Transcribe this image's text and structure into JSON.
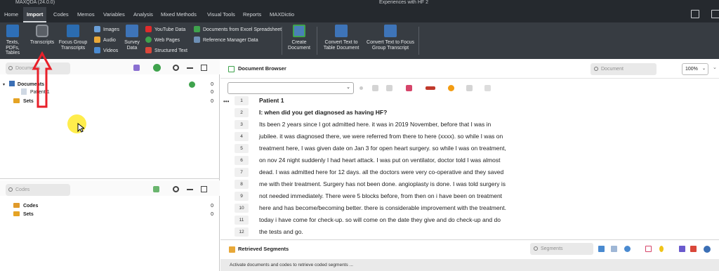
{
  "title_bar": {
    "app_title": "MAXQDA (24.0.0)",
    "window_title": "Experiences with HF 2"
  },
  "menu": [
    "Home",
    "Import",
    "Codes",
    "Memos",
    "Variables",
    "Analysis",
    "Mixed Methods",
    "Visual Tools",
    "Reports",
    "MAXDictio"
  ],
  "menu_active": "Import",
  "ribbon": {
    "texts": "Texts, PDFs, Tables",
    "transcripts": "Transcripts",
    "focus_group": "Focus Group Transcripts",
    "images": "Images",
    "audio": "Audio",
    "videos": "Videos",
    "survey": "Survey Data",
    "youtube": "YouTube Data",
    "web_pages": "Web Pages",
    "structured_text": "Structured Text",
    "excel": "Documents from Excel Spreadsheet",
    "reference": "Reference Manager Data",
    "create_document": "Create Document",
    "convert_table": "Convert Text to Table Document",
    "convert_focus": "Convert Text to Focus Group Transcript"
  },
  "document_system": {
    "search_placeholder": "Documents",
    "root_label": "Documents",
    "root_count": "0",
    "children": [
      {
        "label": "Patient 1",
        "count": "0"
      }
    ],
    "sets_label": "Sets",
    "sets_count": "0"
  },
  "code_system": {
    "search_placeholder": "Codes",
    "codes_label": "Codes",
    "codes_count": "0",
    "sets_label": "Sets",
    "sets_count": "0"
  },
  "document_browser": {
    "title": "Document Browser",
    "search_placeholder": "Document",
    "zoom": "100%",
    "lines": [
      {
        "n": "1",
        "text": "Patient 1",
        "bold": true
      },
      {
        "n": "2",
        "text": "I: when did you get diagnosed as having HF?",
        "bold": true
      },
      {
        "n": "3",
        "text": "Its been 2 years since I got admitted here. it was in 2019 November, before that I was in"
      },
      {
        "n": "4",
        "text": "jubilee. it was diagnosed there, we were referred from there to here (xxxx). so while I was on"
      },
      {
        "n": "5",
        "text": "treatment here, I was given date on Jan 3 for open heart surgery. so while I was on treatment,"
      },
      {
        "n": "6",
        "text": "on nov 24 night suddenly I had heart attack. I was put on ventilator, doctor told I was almost"
      },
      {
        "n": "7",
        "text": "dead. I was admitted here for 12 days. all the doctors were very co-operative and they saved"
      },
      {
        "n": "8",
        "text": "me with their treatment. Surgery has not been done. angioplasty is done. I was told surgery is"
      },
      {
        "n": "9",
        "text": "not needed immediately. There were 5 blocks before, from then on i have been on treatment"
      },
      {
        "n": "10",
        "text": "here and has become/becoming better. there is considerable improvement with the treatment."
      },
      {
        "n": "11",
        "text": "today i have come for check-up. so will come on the date they give and do check-up and do"
      },
      {
        "n": "12",
        "text": "the tests and go."
      }
    ]
  },
  "retrieved_segments": {
    "title": "Retrieved Segments",
    "search_placeholder": "Segments",
    "message": "Activate documents and codes to retrieve coded segments ..."
  },
  "colors": {
    "menubar": "#25292e",
    "ribbon": "#373c42",
    "annotation_arrow": "#e8202a",
    "cursor_highlight": "#ffec3d"
  }
}
